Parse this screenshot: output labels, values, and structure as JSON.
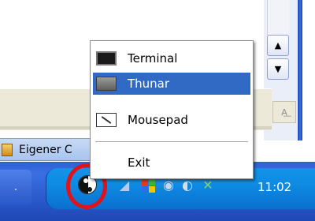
{
  "background_window": {
    "scroll_up_icon": "arrow-up",
    "scroll_down_icon": "arrow-down",
    "tool_icon": "text-format-icon"
  },
  "start_menu": {
    "partial_item_label": "Eigener C"
  },
  "context_menu": {
    "items": [
      {
        "label": "Terminal",
        "icon": "terminal-icon",
        "selected": false
      },
      {
        "label": "Thunar",
        "icon": "folder-icon",
        "selected": true
      },
      {
        "label": "Mousepad",
        "icon": "text-editor-icon",
        "selected": false
      }
    ],
    "exit_label": "Exit",
    "highlight_color": "#316ac5"
  },
  "taskbar": {
    "left_button_label": ".",
    "tray_icons": [
      "yin-yang-icon",
      "speaker-icon",
      "windows-flag-icon",
      "network-icon",
      "security-icon",
      "connection-icon"
    ],
    "clock": "11:02",
    "annotation_color": "#e0121a"
  }
}
